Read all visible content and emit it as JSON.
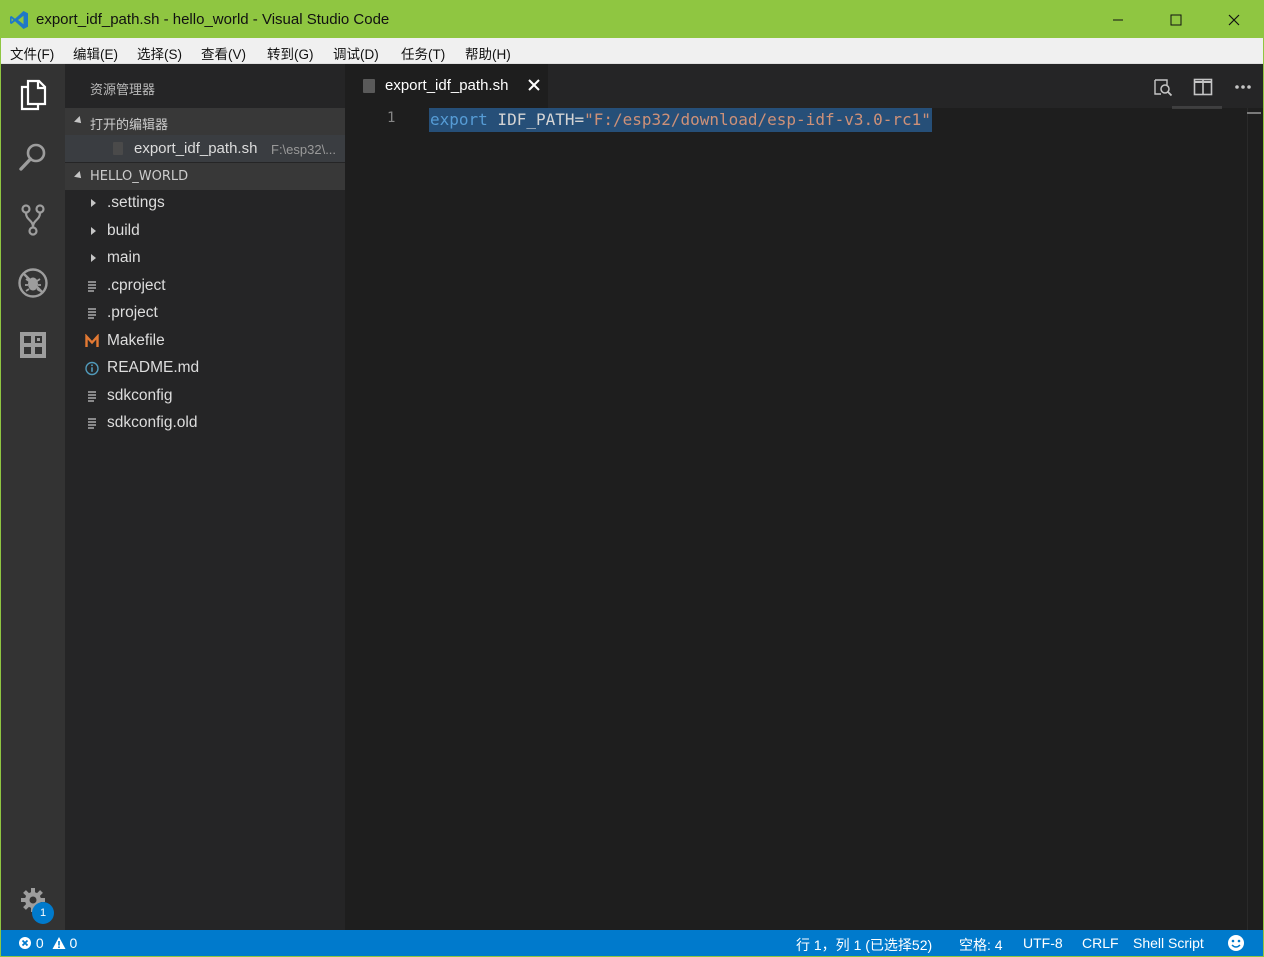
{
  "window": {
    "title": "export_idf_path.sh - hello_world - Visual Studio Code"
  },
  "menu": [
    "文件(F)",
    "编辑(E)",
    "选择(S)",
    "查看(V)",
    "转到(G)",
    "调试(D)",
    "任务(T)",
    "帮助(H)"
  ],
  "activity_bar": {
    "items": [
      "files-icon",
      "search-icon",
      "source-control-icon",
      "debug-icon",
      "extensions-icon"
    ],
    "settings_badge": "1"
  },
  "sidebar": {
    "title": "资源管理器",
    "open_editors": {
      "header": "打开的编辑器",
      "items": [
        {
          "name": "export_idf_path.sh",
          "path": "F:\\esp32\\..."
        }
      ]
    },
    "workspace": {
      "header": "HELLO_WORLD",
      "items": [
        {
          "name": ".settings",
          "kind": "folder"
        },
        {
          "name": "build",
          "kind": "folder"
        },
        {
          "name": "main",
          "kind": "folder"
        },
        {
          "name": ".cproject",
          "kind": "file"
        },
        {
          "name": ".project",
          "kind": "file"
        },
        {
          "name": "Makefile",
          "kind": "makefile"
        },
        {
          "name": "README.md",
          "kind": "info"
        },
        {
          "name": "sdkconfig",
          "kind": "file"
        },
        {
          "name": "sdkconfig.old",
          "kind": "file"
        }
      ]
    }
  },
  "editor": {
    "tab": {
      "label": "export_idf_path.sh"
    },
    "lines": [
      {
        "number": "1",
        "keyword": "export",
        "variable": " IDF_PATH=",
        "string": "\"F:/esp32/download/esp-idf-v3.0-rc1\""
      }
    ]
  },
  "status_bar": {
    "errors": "0",
    "warnings": "0",
    "position": "行 1，列 1 (已选择52)",
    "indent": "空格: 4",
    "encoding": "UTF-8",
    "eol": "CRLF",
    "language": "Shell Script"
  },
  "colors": {
    "title_bar": "#8fc641",
    "activity_bar": "#333333",
    "sidebar": "#252526",
    "editor": "#1e1e1e",
    "status_bar": "#007acc",
    "selection": "#264f78"
  }
}
